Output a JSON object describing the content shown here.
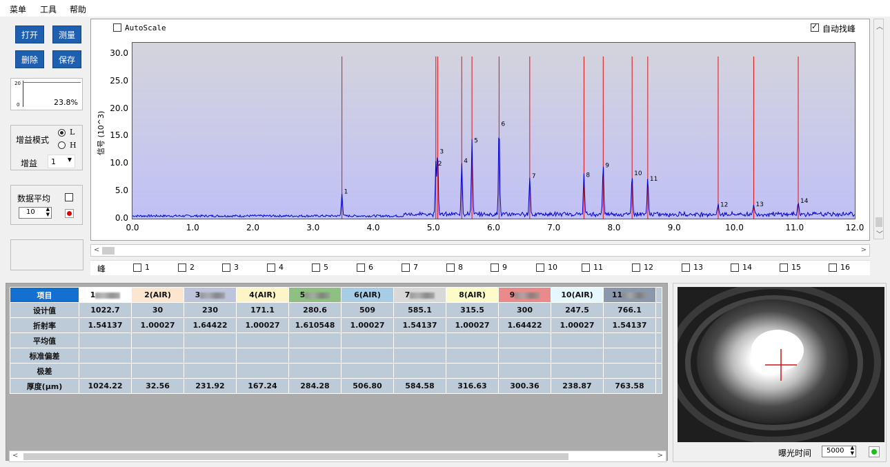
{
  "menu": [
    "菜单",
    "工具",
    "帮助"
  ],
  "buttons": {
    "open": "打开",
    "measure": "测量",
    "delete": "删除",
    "save": "保存"
  },
  "mini_chart": {
    "ymax": "20",
    "ymin": "0",
    "percent": "23.8%"
  },
  "gain": {
    "mode_label": "增益模式",
    "option_l": "L",
    "option_h": "H",
    "selected": "L",
    "gain_label": "增益",
    "gain_value": "1"
  },
  "average": {
    "label": "数据平均",
    "value": "10",
    "checked": false
  },
  "chart_controls": {
    "autoscale_label": "AutoScale",
    "autoscale_checked": false,
    "peakfind_label": "自动找峰",
    "peakfind_checked": true
  },
  "chart_data": {
    "type": "line",
    "ylabel": "信号 (10^3)",
    "xlim": [
      0,
      12
    ],
    "ylim": [
      0,
      32
    ],
    "x_ticks": [
      "0.0",
      "1.0",
      "2.0",
      "3.0",
      "4.0",
      "5.0",
      "6.0",
      "7.0",
      "8.0",
      "9.0",
      "10.0",
      "11.0",
      "12.0"
    ],
    "y_ticks": [
      "0.0",
      "5.0",
      "10.0",
      "15.0",
      "20.0",
      "25.0",
      "30.0"
    ],
    "peaks": [
      {
        "label": "1",
        "x": 3.48,
        "y": 4.2
      },
      {
        "label": "2",
        "x": 5.04,
        "y": 9.3
      },
      {
        "label": "3",
        "x": 5.07,
        "y": 11.5
      },
      {
        "label": "4",
        "x": 5.47,
        "y": 9.8
      },
      {
        "label": "5",
        "x": 5.64,
        "y": 13.5
      },
      {
        "label": "6",
        "x": 6.09,
        "y": 16.5
      },
      {
        "label": "7",
        "x": 6.6,
        "y": 7.0
      },
      {
        "label": "8",
        "x": 7.5,
        "y": 7.2
      },
      {
        "label": "9",
        "x": 7.82,
        "y": 9.0
      },
      {
        "label": "10",
        "x": 8.3,
        "y": 7.5
      },
      {
        "label": "11",
        "x": 8.56,
        "y": 6.5
      },
      {
        "label": "12",
        "x": 9.73,
        "y": 1.8
      },
      {
        "label": "13",
        "x": 10.32,
        "y": 1.9
      },
      {
        "label": "14",
        "x": 11.06,
        "y": 2.5
      }
    ],
    "markers_x": [
      3.48,
      5.04,
      5.07,
      5.47,
      5.64,
      6.09,
      6.6,
      7.5,
      7.82,
      8.3,
      8.56,
      9.73,
      10.32,
      11.06
    ],
    "marker_top": 29.5
  },
  "peak_row": {
    "label": "峰",
    "items": [
      "1",
      "2",
      "3",
      "4",
      "5",
      "6",
      "7",
      "8",
      "9",
      "10",
      "11",
      "12",
      "13",
      "14",
      "15",
      "16"
    ]
  },
  "table": {
    "row_headers": [
      "项目",
      "设计值",
      "折射率",
      "平均值",
      "标准偏差",
      "极差",
      "厚度(μm)"
    ],
    "columns": [
      {
        "name": "1",
        "blur": true,
        "color": "#ffffff",
        "design": "1022.7",
        "index": "1.54137",
        "thickness": "1024.22"
      },
      {
        "name": "2(AIR)",
        "blur": false,
        "color": "#fde6cf",
        "design": "30",
        "index": "1.00027",
        "thickness": "32.56"
      },
      {
        "name": "3",
        "blur": true,
        "color": "#bcc5dc",
        "design": "230",
        "index": "1.64422",
        "thickness": "231.92"
      },
      {
        "name": "4(AIR)",
        "blur": false,
        "color": "#fdf5c8",
        "design": "171.1",
        "index": "1.00027",
        "thickness": "167.24"
      },
      {
        "name": "5",
        "blur": true,
        "color": "#8ec081",
        "design": "280.6",
        "index": "1.610548",
        "thickness": "284.28"
      },
      {
        "name": "6(AIR)",
        "blur": false,
        "color": "#a7cde6",
        "design": "509",
        "index": "1.00027",
        "thickness": "506.80"
      },
      {
        "name": "7",
        "blur": true,
        "color": "#d8d8d8",
        "design": "585.1",
        "index": "1.54137",
        "thickness": "584.58"
      },
      {
        "name": "8(AIR)",
        "blur": false,
        "color": "#fdfbc8",
        "design": "315.5",
        "index": "1.00027",
        "thickness": "316.63"
      },
      {
        "name": "9",
        "blur": true,
        "color": "#ea8a8a",
        "design": "300",
        "index": "1.64422",
        "thickness": "300.36"
      },
      {
        "name": "10(AIR)",
        "blur": false,
        "color": "#e7f7ff",
        "design": "247.5",
        "index": "1.00027",
        "thickness": "238.87"
      },
      {
        "name": "11",
        "blur": true,
        "color": "#8b97ab",
        "design": "766.1",
        "index": "1.54137",
        "thickness": "763.58"
      }
    ]
  },
  "camera": {
    "exposure_label": "曝光时间",
    "exposure_value": "5000"
  }
}
